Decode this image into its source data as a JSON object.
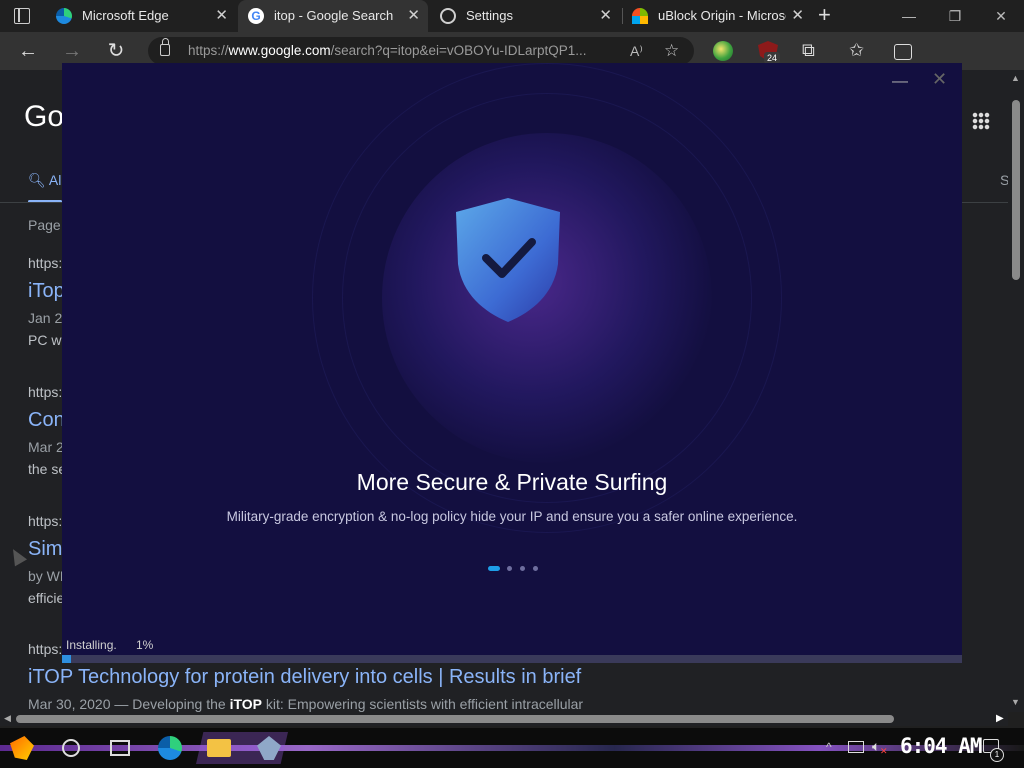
{
  "browser": {
    "tabs": [
      {
        "title": "Microsoft Edge",
        "favicon": "edge-icon"
      },
      {
        "title": "itop - Google Search",
        "favicon": "google-icon"
      },
      {
        "title": "Settings",
        "favicon": "gear-icon"
      },
      {
        "title": "uBlock Origin - Microsoft",
        "favicon": "microsoft-icon"
      }
    ],
    "active_tab_index": 1,
    "url_prefix": "https://",
    "url_host": "www.google.com",
    "url_rest": "/search?q=itop&ei=vOBOYu-IDLarptQP1...",
    "ublock_badge": "24"
  },
  "search_page": {
    "logo": "Go",
    "all_tab": "Al",
    "right_tab": "S",
    "results": [
      {
        "kind": "meta",
        "text": "Page"
      },
      {
        "kind": "url",
        "text": "https:"
      },
      {
        "kind": "link",
        "text": "iTop"
      },
      {
        "kind": "meta",
        "text": "Jan 2"
      },
      {
        "kind": "txt",
        "text": "PC wi"
      },
      {
        "kind": "url",
        "text": "https:"
      },
      {
        "kind": "link",
        "text": "Con"
      },
      {
        "kind": "meta",
        "text": "Mar 2"
      },
      {
        "kind": "txt",
        "text": "the se"
      },
      {
        "kind": "url",
        "text": "https:"
      },
      {
        "kind": "link",
        "text": "Sim"
      },
      {
        "kind": "meta",
        "text": "by WN"
      },
      {
        "kind": "txt",
        "text": "efficie"
      },
      {
        "kind": "url",
        "text": "https:"
      },
      {
        "kind": "link",
        "text": "iTOP Technology for protein delivery into cells | Results in brief"
      }
    ],
    "last_snippet_date": "Mar 30, 2020 — Developing the ",
    "last_snippet_bold": "iTOP",
    "last_snippet_rest": " kit: Empowering scientists with efficient intracellular"
  },
  "installer": {
    "headline": "More Secure & Private Surfing",
    "subline": "Military-grade encryption & no-log policy hide your IP and ensure you a safer online experience.",
    "status": "Installing.",
    "percent_label": "1%",
    "progress": 0.01,
    "carousel_count": 4,
    "carousel_active": 0,
    "accent_color": "#2e8fe0",
    "background_color": "#130f40"
  },
  "taskbar": {
    "clock": "6:04 AM",
    "notification_count": "1",
    "items": [
      "start-icon",
      "search-icon",
      "task-view-icon",
      "edge-icon",
      "file-explorer-icon",
      "installer-icon"
    ]
  }
}
